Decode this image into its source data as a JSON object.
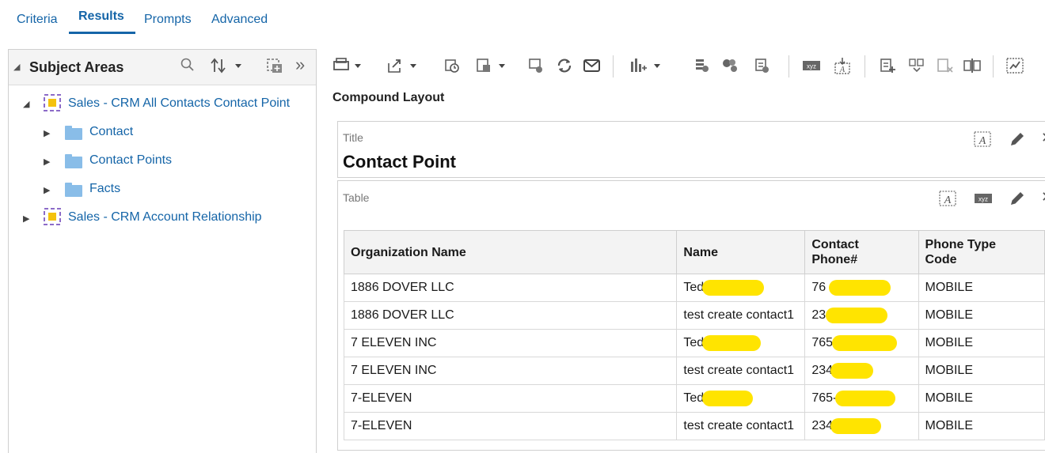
{
  "tabs": [
    {
      "label": "Criteria",
      "active": false
    },
    {
      "label": "Results",
      "active": true
    },
    {
      "label": "Prompts",
      "active": false
    },
    {
      "label": "Advanced",
      "active": false
    }
  ],
  "subject_areas": {
    "title": "Subject Areas",
    "tree": [
      {
        "label": "Sales - CRM All Contacts Contact Point",
        "expanded": true,
        "children": [
          {
            "label": "Contact"
          },
          {
            "label": "Contact Points"
          },
          {
            "label": "Facts"
          }
        ]
      },
      {
        "label": "Sales - CRM Account Relationship",
        "expanded": false
      }
    ]
  },
  "compound_layout": {
    "label": "Compound Layout",
    "title_view": {
      "caption": "Title",
      "title": "Contact Point"
    },
    "table_view": {
      "caption": "Table"
    }
  },
  "table": {
    "headers": [
      "Organization Name",
      "Name",
      "Contact Phone#",
      "Phone Type Code"
    ],
    "rows": [
      [
        "1886 DOVER LLC",
        "Ted",
        "76",
        "MOBILE"
      ],
      [
        "1886 DOVER LLC",
        "test create contact1",
        "23",
        "MOBILE"
      ],
      [
        "7 ELEVEN INC",
        "Ted",
        "765",
        "MOBILE"
      ],
      [
        "7 ELEVEN INC",
        "test create contact1",
        "234",
        "MOBILE"
      ],
      [
        "7-ELEVEN",
        "Ted",
        "765-",
        "MOBILE"
      ],
      [
        "7-ELEVEN",
        "test create contact1",
        "234",
        "MOBILE"
      ]
    ]
  },
  "colors": {
    "accent": "#1565a8",
    "redaction": "#ffe400",
    "folder": "#89bde8"
  }
}
